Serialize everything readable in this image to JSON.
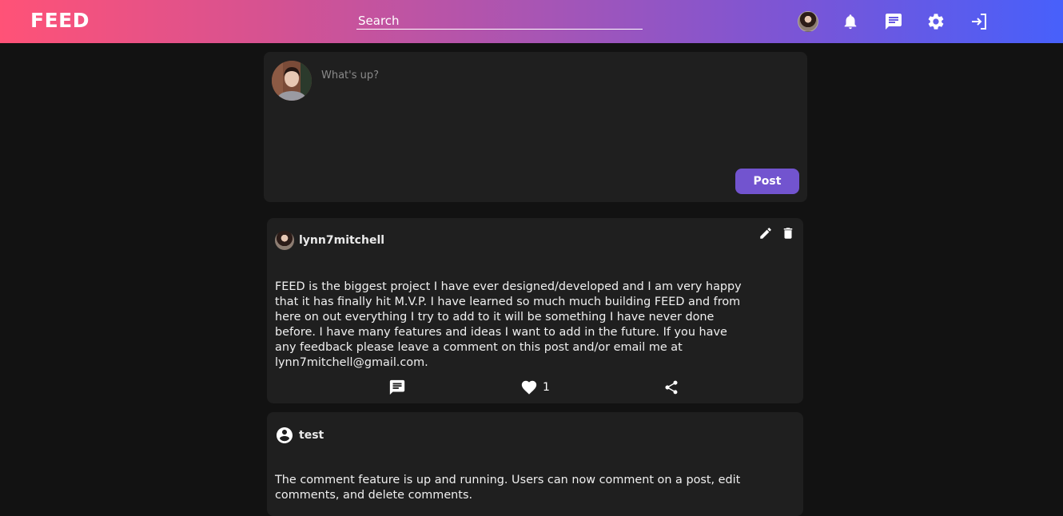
{
  "header": {
    "brand": "FEED",
    "search_placeholder": "Search"
  },
  "composer": {
    "placeholder": "What's up?",
    "post_label": "Post"
  },
  "posts": [
    {
      "author": "lynn7mitchell",
      "text": "FEED is the biggest project I have ever designed/developed and I am very happy that it has finally hit M.V.P. I have learned so much much building FEED and from here on out everything I try to add to it will be something I have never done before. I have many features and ideas I want to add in the future. If you have any feedback please leave a comment on this post and/or email me at lynn7mitchell@gmail.com.",
      "likes": "1"
    },
    {
      "author": "test",
      "text": "The comment feature is up and running. Users can now comment on a post, edit comments, and delete comments."
    }
  ],
  "icons": {
    "notifications": "bell-icon",
    "messages": "chat-icon",
    "settings": "gear-icon",
    "logout": "logout-icon",
    "edit": "pencil-icon",
    "delete": "trash-icon",
    "comment": "comment-icon",
    "like": "heart-icon",
    "share": "share-icon",
    "default_avatar": "account-circle-icon"
  },
  "colors": {
    "accent": "#7254cf",
    "gradient_start": "#ff5277",
    "gradient_end": "#4760fb",
    "background": "#121212",
    "card": "#1f1f1f"
  }
}
